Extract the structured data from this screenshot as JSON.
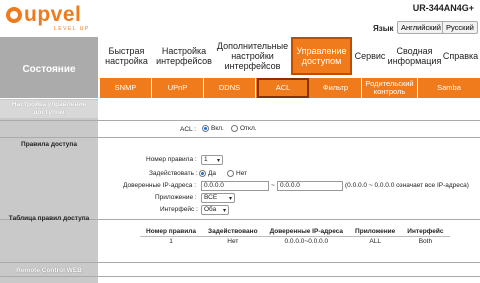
{
  "header": {
    "logo_text": "upvel",
    "logo_sub": "LEVEL UP",
    "model": "UR-344AN4G+",
    "lang_label": "Язык",
    "lang_english": "Английский",
    "lang_russian": "Русский"
  },
  "sidebar": {
    "main": "Состояние",
    "sub": "Настройка управления доступом"
  },
  "main_tabs": [
    {
      "label": "Быстрая настройка"
    },
    {
      "label": "Настройка интерфейсов"
    },
    {
      "label": "Дополнительные настройки интерфейсов"
    },
    {
      "label": "Управление доступом"
    },
    {
      "label": "Сервис"
    },
    {
      "label": "Сводная информация"
    },
    {
      "label": "Справка"
    }
  ],
  "sub_tabs": [
    {
      "label": "SNMP"
    },
    {
      "label": "UPnP"
    },
    {
      "label": "DDNS"
    },
    {
      "label": "ACL"
    },
    {
      "label": "Фильтр"
    },
    {
      "label": "Родительский контроль"
    },
    {
      "label": "Samba"
    }
  ],
  "acl": {
    "label": "ACL :",
    "on": "Вкл.",
    "off": "Откл."
  },
  "access_rule": {
    "section": "Правила доступа",
    "rule_number_label": "Номер правила :",
    "rule_number_value": "1",
    "active_label": "Задействовать :",
    "yes": "Да",
    "no": "Нет",
    "ip_label": "Доверенные IP-адреса :",
    "ip_from": "0.0.0.0",
    "ip_sep": "~",
    "ip_to": "0.0.0.0",
    "ip_hint": "(0.0.0.0 ~ 0.0.0.0 означает все IP-адреса)",
    "app_label": "Приложение :",
    "app_value": "ВСЕ",
    "iface_label": "Интерфейс :",
    "iface_value": "Оба"
  },
  "rules_table": {
    "section": "Таблица правил доступа",
    "headers": [
      "Номер правила",
      "Задействовано",
      "Доверенные IP-адреса",
      "Приложение",
      "Интерфейс"
    ],
    "rows": [
      [
        "1",
        "Нет",
        "0.0.0.0~0.0.0.0",
        "ALL",
        "Both"
      ]
    ]
  },
  "remote": {
    "section": "Remote Control WEB"
  }
}
